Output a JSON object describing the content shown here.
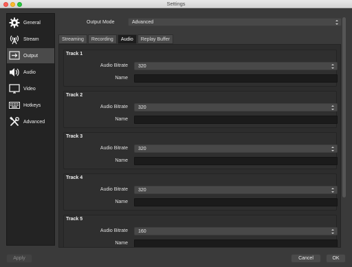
{
  "window": {
    "title": "Settings"
  },
  "sidebar": {
    "items": [
      {
        "label": "General",
        "icon": "gear-icon"
      },
      {
        "label": "Stream",
        "icon": "broadcast-tower-icon"
      },
      {
        "label": "Output",
        "icon": "output-icon"
      },
      {
        "label": "Audio",
        "icon": "speaker-icon"
      },
      {
        "label": "Video",
        "icon": "monitor-icon"
      },
      {
        "label": "Hotkeys",
        "icon": "keyboard-icon"
      },
      {
        "label": "Advanced",
        "icon": "tools-icon"
      }
    ],
    "active": "Output"
  },
  "output_mode": {
    "label": "Output Mode",
    "value": "Advanced"
  },
  "tabs": [
    {
      "label": "Streaming"
    },
    {
      "label": "Recording"
    },
    {
      "label": "Audio"
    },
    {
      "label": "Replay Buffer"
    }
  ],
  "active_tab": "Audio",
  "tracks": [
    {
      "title": "Track 1",
      "bitrate_label": "Audio Bitrate",
      "bitrate": "320",
      "name_label": "Name",
      "name": ""
    },
    {
      "title": "Track 2",
      "bitrate_label": "Audio Bitrate",
      "bitrate": "320",
      "name_label": "Name",
      "name": ""
    },
    {
      "title": "Track 3",
      "bitrate_label": "Audio Bitrate",
      "bitrate": "320",
      "name_label": "Name",
      "name": ""
    },
    {
      "title": "Track 4",
      "bitrate_label": "Audio Bitrate",
      "bitrate": "320",
      "name_label": "Name",
      "name": ""
    },
    {
      "title": "Track 5",
      "bitrate_label": "Audio Bitrate",
      "bitrate": "160",
      "name_label": "Name",
      "name": ""
    }
  ],
  "buttons": {
    "apply": "Apply",
    "cancel": "Cancel",
    "ok": "OK"
  },
  "colors": {
    "background": "#3a3a3a",
    "sidebar": "#232323",
    "selected": "#4a4a4a",
    "field": "#1b1b1b"
  }
}
